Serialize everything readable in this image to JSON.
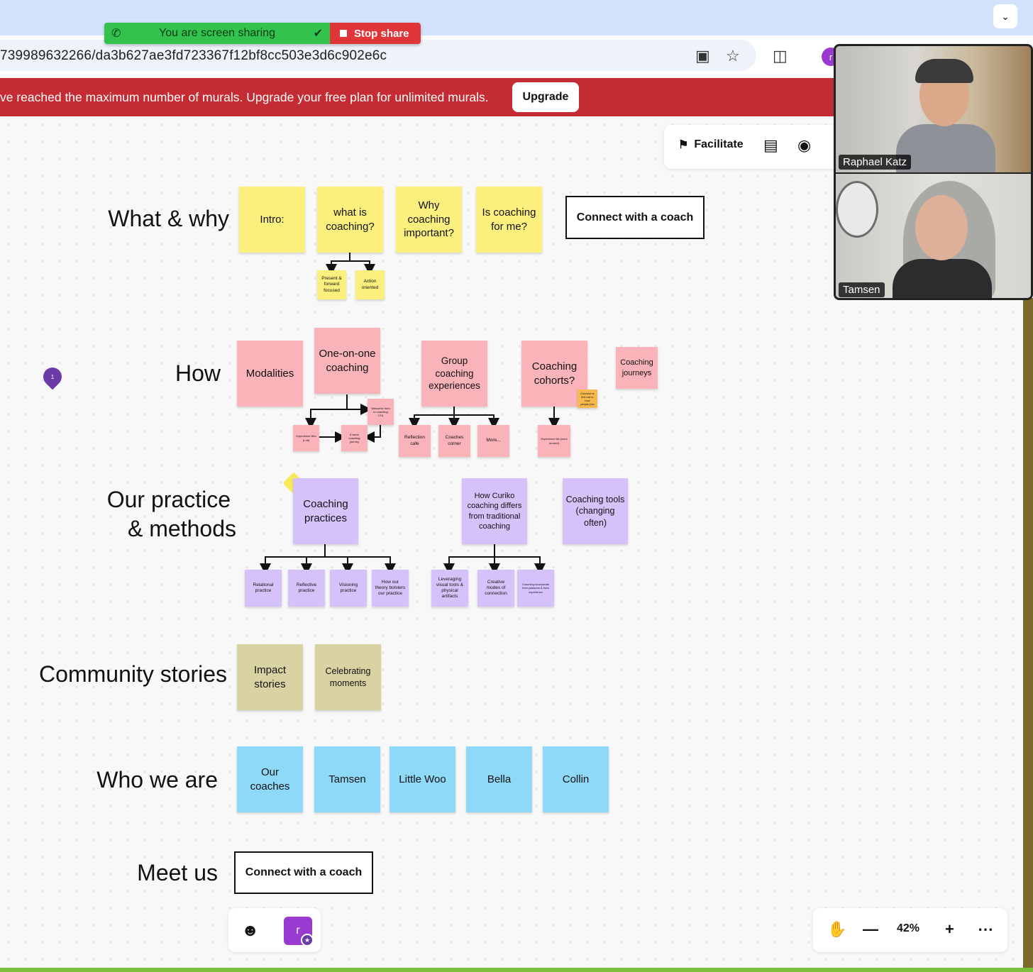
{
  "screen_share": {
    "status": "You are screen sharing",
    "stop_label": "Stop share"
  },
  "browser": {
    "url": "739989632266/da3b627ae3fd723367f12bf8cc503e3d6c902e6c",
    "profile_initial": "r"
  },
  "banner": {
    "text": "ve reached the maximum number of murals. Upgrade your free plan for unlimited murals.",
    "upgrade_label": "Upgrade",
    "color": "#c42b32"
  },
  "toolbar": {
    "facilitate_label": "Facilitate"
  },
  "rows": {
    "what_why": {
      "label": "What & why",
      "stickies": [
        "Intro:",
        "what is coaching?",
        "Why coaching important?",
        "Is coaching for me?"
      ],
      "sub_stickies": [
        "Present & forward focused",
        "Action oriented"
      ],
      "cta": "Connect with a coach"
    },
    "how": {
      "label": "How",
      "stickies": [
        "Modalities",
        "One-on-one coaching",
        "Group coaching experiences",
        "Coaching cohorts?",
        "Coaching journeys"
      ],
      "one_on_one_children": [
        "Welcome/ intro to coaching CTA",
        "Experience tiles (f off)",
        "6 week coaching journey"
      ],
      "group_children": [
        "Reflection cafe",
        "Coaches corner",
        "More..."
      ],
      "cohort_children": [
        "Experience tile (work around)",
        "Welcome/intro"
      ],
      "cohort_note": "Connect or link out to how people join"
    },
    "practice": {
      "label_line1": "Our practice",
      "label_line2": "& methods",
      "stickies": [
        "Coaching practices",
        "How Curiko coaching differs from traditional coaching",
        "Coaching tools (changing often)"
      ],
      "practice_children": [
        "Relational practice",
        "Reflective practice",
        "Visioning practice",
        "How our theory bolsters our practice"
      ],
      "differs_children": [
        "Leveraging visual tools & physical artifacts",
        "Creative modes of connection",
        "Coaching incorporate their passions & lives experience"
      ]
    },
    "community": {
      "label": "Community stories",
      "stickies": [
        "Impact stories",
        "Celebrating moments"
      ]
    },
    "who": {
      "label": "Who we are",
      "stickies": [
        "Our coaches",
        "Tamsen",
        "Little Woo",
        "Bella",
        "Collin"
      ]
    },
    "meet": {
      "label": "Meet us",
      "cta": "Connect with a coach"
    }
  },
  "pin_count": "1",
  "user_initial": "r",
  "zoom": "42%",
  "video": {
    "participants": [
      "Raphael Katz",
      "Tamsen"
    ]
  },
  "colors": {
    "yellow": "#fbef7e",
    "pink": "#f9b3b9",
    "violet": "#d6c2fb",
    "khaki": "#d9d3a4",
    "blue": "#8ed9f8",
    "orange": "#f7b94d",
    "share_green": "#33c24d",
    "stop_red": "#e0363a"
  },
  "icons": [
    "phone-icon",
    "shield-check-icon",
    "stop-icon",
    "install-icon",
    "star-icon",
    "extensions-icon",
    "chevron-down-icon",
    "facilitate-icon",
    "outline-icon",
    "comment-icon",
    "map-pin-icon",
    "emoji-icon",
    "hand-icon",
    "zoom-out-icon",
    "zoom-in-icon",
    "more-icon"
  ]
}
